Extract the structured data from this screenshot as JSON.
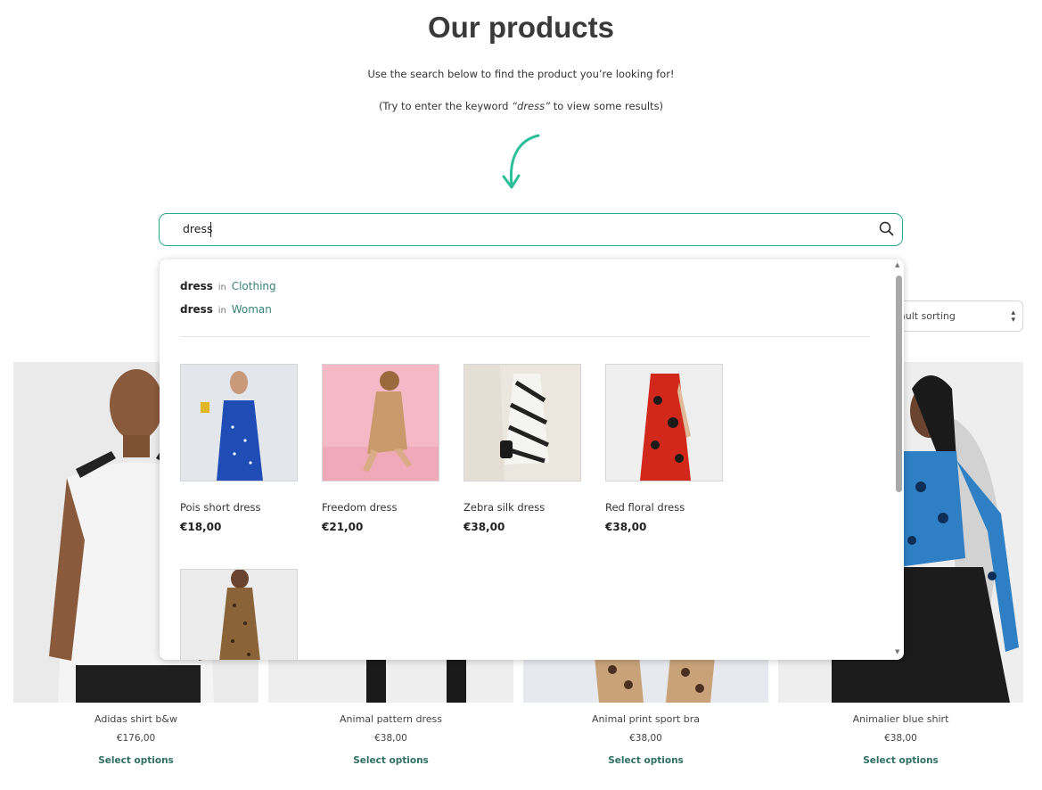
{
  "header": {
    "title": "Our products",
    "intro": "Use the search below to find the product you’re looking for!",
    "hint_prefix": "(Try to enter the keyword ",
    "hint_keyword": "“dress”",
    "hint_suffix": " to view some results)"
  },
  "search": {
    "value": "dress",
    "icon": "search-icon",
    "accent": "#2aa88e"
  },
  "sort": {
    "visible_text": "ault sorting"
  },
  "suggestions": [
    {
      "term": "dress",
      "in": "in",
      "category": "Clothing"
    },
    {
      "term": "dress",
      "in": "in",
      "category": "Woman"
    }
  ],
  "results": [
    {
      "name": "Pois short dress",
      "price": "€18,00"
    },
    {
      "name": "Freedom dress",
      "price": "€21,00"
    },
    {
      "name": "Zebra silk dress",
      "price": "€38,00"
    },
    {
      "name": "Red floral dress",
      "price": "€38,00"
    },
    {
      "name": "",
      "price": ""
    }
  ],
  "products": [
    {
      "name": "Adidas shirt b&w",
      "price": "€176,00",
      "action": "Select options"
    },
    {
      "name": "Animal pattern dress",
      "price": "€38,00",
      "action": "Select options"
    },
    {
      "name": "Animal print sport bra",
      "price": "€38,00",
      "action": "Select options"
    },
    {
      "name": "Animalier blue shirt",
      "price": "€38,00",
      "action": "Select options"
    }
  ]
}
